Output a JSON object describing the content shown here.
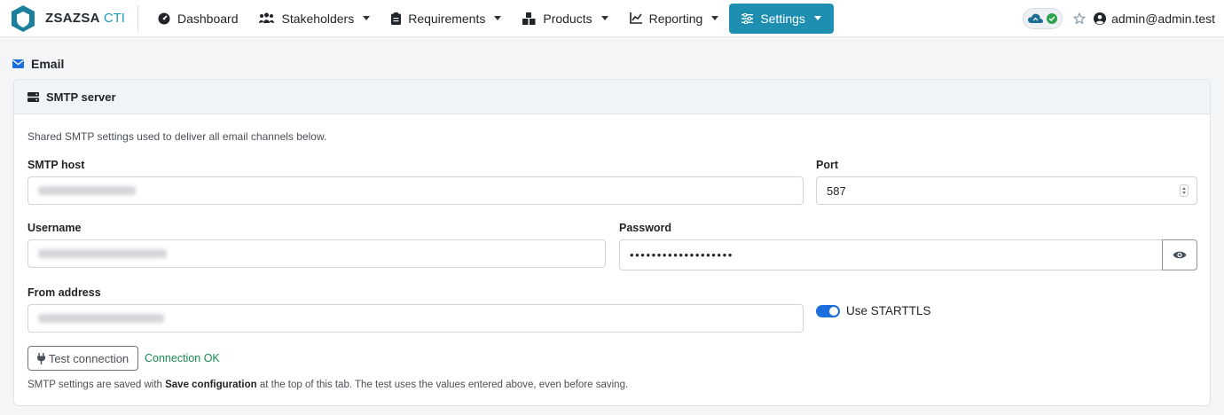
{
  "brand": {
    "name": "ZSAZSA",
    "sub": "CTI"
  },
  "nav": {
    "items": [
      {
        "label": "Dashboard",
        "icon": "tachometer-icon",
        "dropdown": false
      },
      {
        "label": "Stakeholders",
        "icon": "users-icon",
        "dropdown": true
      },
      {
        "label": "Requirements",
        "icon": "clipboard-icon",
        "dropdown": true
      },
      {
        "label": "Products",
        "icon": "cubes-icon",
        "dropdown": true
      },
      {
        "label": "Reporting",
        "icon": "chart-line-icon",
        "dropdown": true
      },
      {
        "label": "Settings",
        "icon": "sliders-icon",
        "dropdown": true,
        "active": true
      }
    ],
    "user": "admin@admin.test"
  },
  "section": {
    "title": "Email"
  },
  "card": {
    "header": "SMTP server",
    "intro": "Shared SMTP settings used to deliver all email channels below.",
    "host": {
      "label": "SMTP host",
      "value": ""
    },
    "port": {
      "label": "Port",
      "value": "587"
    },
    "username": {
      "label": "Username",
      "value": ""
    },
    "password": {
      "label": "Password",
      "value": "•••••••••••••••••••"
    },
    "from": {
      "label": "From address",
      "value": ""
    },
    "starttls": {
      "label": "Use STARTTLS",
      "checked": true
    },
    "test_button": "Test connection",
    "connection_status": "Connection OK",
    "footnote": {
      "before": "SMTP settings are saved with ",
      "bold": "Save configuration",
      "after": " at the top of this tab. The test uses the values entered above, even before saving."
    }
  },
  "colors": {
    "accent": "#1e8fb0",
    "toggle": "#1a6fdc",
    "success": "#198754"
  }
}
